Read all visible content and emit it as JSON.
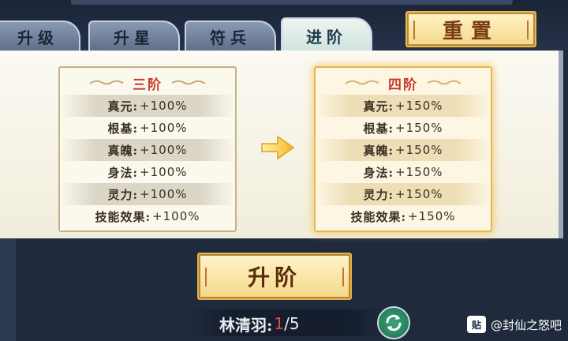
{
  "tabs": [
    {
      "label": "升级",
      "active": false
    },
    {
      "label": "升星",
      "active": false
    },
    {
      "label": "符兵",
      "active": false
    },
    {
      "label": "进阶",
      "active": true
    }
  ],
  "reset_label": "重置",
  "current_card": {
    "title": "三阶",
    "stats": [
      {
        "name": "真元:",
        "value": "+100%"
      },
      {
        "name": "根基:",
        "value": "+100%"
      },
      {
        "name": "真魄:",
        "value": "+100%"
      },
      {
        "name": "身法:",
        "value": "+100%"
      },
      {
        "name": "灵力:",
        "value": "+100%"
      },
      {
        "name": "技能效果:",
        "value": "+100%"
      }
    ]
  },
  "next_card": {
    "title": "四阶",
    "stats": [
      {
        "name": "真元:",
        "value": "+150%"
      },
      {
        "name": "根基:",
        "value": "+150%"
      },
      {
        "name": "真魄:",
        "value": "+150%"
      },
      {
        "name": "身法:",
        "value": "+150%"
      },
      {
        "name": "灵力:",
        "value": "+150%"
      },
      {
        "name": "技能效果:",
        "value": "+150%"
      }
    ]
  },
  "advance_label": "升阶",
  "character": {
    "name": "林清羽:",
    "count_current": "1",
    "count_total": "/5"
  },
  "watermark": {
    "logo": "贴",
    "text": "@封仙之怒吧"
  },
  "colors": {
    "accent_red": "#c63a2d",
    "button_gold": "#f4d889",
    "active_tab": "#cfe3de",
    "refresh_green": "#2f8a64"
  },
  "icons": {
    "arrow": "right-arrow-icon",
    "refresh": "refresh-icon"
  }
}
